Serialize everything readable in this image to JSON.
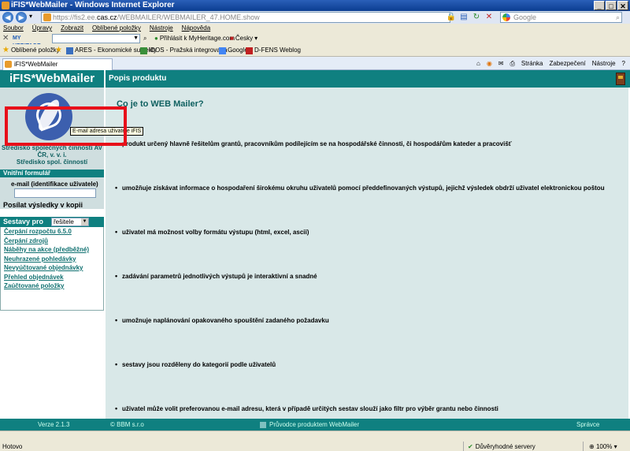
{
  "window": {
    "title": "iFIS*WebMailer - Windows Internet Explorer",
    "controls": [
      "_",
      "□",
      "✕"
    ]
  },
  "address": {
    "scheme": "https://",
    "host_pre": "fis2.ee.",
    "host": "cas.cz",
    "path": "/WEBMAILER/WEBMAILER_47.HOME.show",
    "search_placeholder": "Google"
  },
  "menu": [
    "Soubor",
    "Úpravy",
    "Zobrazit",
    "Oblíbené položky",
    "Nástroje",
    "Nápověda"
  ],
  "toolbar": {
    "logo": "MY HERITAGE",
    "signin": "Přihlásit k MyHeritage.com",
    "language": "Česky"
  },
  "favorites": {
    "label": "Oblíbené položky",
    "items": [
      "ARES - Ekonomické subjekty",
      "IDOS - Pražská integrovaná ...",
      "Google",
      "D-FENS Weblog"
    ]
  },
  "tabs": {
    "active": "iFIS*WebMailer",
    "tools": [
      "Stránka",
      "Zabezpečení",
      "Nástroje",
      "?"
    ]
  },
  "app": {
    "brand": "iFIS*WebMailer",
    "page_title": "Popis produktu",
    "org_line1": "Středisko společných činností AV",
    "org_line2": "ČR, v. v. i.",
    "org_line3": "Středisko spol. činností",
    "user_header": "Vnitřní formulář",
    "email_label": "e-mail (identifikace uživatele)",
    "email_value": "",
    "send_results": "Posílat výsledky v kopii",
    "tooltip": "E-mail adresa uživatele iFIS",
    "reports_label": "Sestavy pro",
    "role_value": "řešitele",
    "reports": [
      "Čerpání rozpočtu 6.5.0",
      "Čerpání zdrojů",
      "Náběhy na akce (předběžné)",
      "Neuhrazené pohledávky",
      "Nevyúčtované objednávky",
      "Přehled objednávek",
      "Zaúčtované položky"
    ],
    "content_title": "Co je to WEB Mailer?",
    "bullets": [
      "produkt určený hlavně řešitelům grantů, pracovníkům podílejícím se na hospodářské činnosti, či hospodářům kateder a pracovišť",
      "umožňuje získávat informace o hospodaření širokému okruhu uživatelů pomocí předdefinovaných výstupů, jejichž výsledek obdrží uživatel elektronickou poštou",
      "uživatel má možnost volby formátu výstupu (html, excel, ascii)",
      "zadávání parametrů jednotlivých výstupů je interaktivní a snadné",
      "umožnuje naplánování opakovaného spouštění zadaného požadavku",
      "sestavy jsou rozděleny do kategorií podle uživatelů",
      "uživatel může volit preferovanou e-mail adresu, která v případě určitých sestav slouží jako filtr pro výběr grantu nebo činnosti"
    ],
    "footer": {
      "version": "Verze 2.1.3",
      "copyright": "© BBM s.r.o",
      "guide": "Průvodce produktem WebMailer",
      "admin": "Správce WebMaileru"
    }
  },
  "status": {
    "text": "Hotovo",
    "zone": "Důvěryhodné servery",
    "zoom": "100%"
  }
}
